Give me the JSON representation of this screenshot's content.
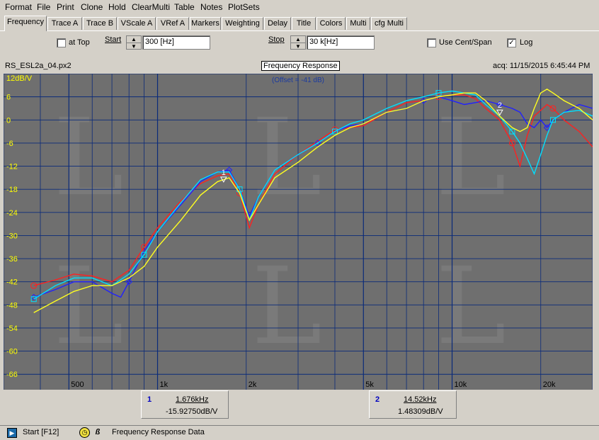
{
  "menu": [
    "Format",
    "File",
    "Print",
    "Clone",
    "Hold",
    "ClearMulti",
    "Table",
    "Notes",
    "PlotSets"
  ],
  "tabs": [
    "Frequency",
    "Trace A",
    "Trace B",
    "VScale A",
    "VRef A",
    "Markers",
    "Weighting",
    "Delay",
    "Title",
    "Colors",
    "Multi",
    "cfg Multi"
  ],
  "toolbar": {
    "at_top_label": "at Top",
    "start_label": "Start",
    "start_value": "300 [Hz]",
    "stop_label": "Stop",
    "stop_value": "30 k[Hz]",
    "use_cent_span_label": "Use Cent/Span",
    "log_label": "Log",
    "log_checked": "✓"
  },
  "header": {
    "file_name": "RS_ESL2a_04.px2",
    "plot_title": "Frequency Response",
    "acq": "acq: 11/15/2015 6:45:44 PM",
    "offset": "(Offset = -41 dB)"
  },
  "chart_data": {
    "type": "line",
    "xscale": "log",
    "xlim": [
      300,
      30000
    ],
    "ylim": [
      -70,
      12
    ],
    "ylabel": "12dB/V",
    "y_ticks": [
      6,
      0,
      -6,
      -12,
      -18,
      -24,
      -30,
      -36,
      -42,
      -48,
      -54,
      -60,
      -66
    ],
    "x_tick_labels": [
      {
        "f": 500,
        "label": "500"
      },
      {
        "f": 1000,
        "label": "1k"
      },
      {
        "f": 2000,
        "label": "2k"
      },
      {
        "f": 5000,
        "label": "5k"
      },
      {
        "f": 10000,
        "label": "10k"
      },
      {
        "f": 20000,
        "label": "20k"
      }
    ],
    "grid": true,
    "series": [
      {
        "color": "#ff2020",
        "points": [
          [
            380,
            -43
          ],
          [
            450,
            -41.5
          ],
          [
            520,
            -40
          ],
          [
            600,
            -40.5
          ],
          [
            700,
            -42
          ],
          [
            800,
            -39
          ],
          [
            900,
            -33
          ],
          [
            1000,
            -28
          ],
          [
            1200,
            -21
          ],
          [
            1400,
            -16.5
          ],
          [
            1600,
            -14.5
          ],
          [
            1750,
            -14
          ],
          [
            1900,
            -19
          ],
          [
            2050,
            -28
          ],
          [
            2200,
            -22
          ],
          [
            2500,
            -14
          ],
          [
            3000,
            -9
          ],
          [
            3500,
            -5.5
          ],
          [
            4000,
            -2.5
          ],
          [
            4500,
            -2
          ],
          [
            5000,
            -1.5
          ],
          [
            6000,
            2
          ],
          [
            7000,
            4.5
          ],
          [
            8000,
            5
          ],
          [
            9000,
            6
          ],
          [
            10000,
            6.5
          ],
          [
            11000,
            6.5
          ],
          [
            12000,
            5.5
          ],
          [
            13000,
            3
          ],
          [
            14500,
            0
          ],
          [
            16000,
            -6
          ],
          [
            17000,
            -12
          ],
          [
            18000,
            -4
          ],
          [
            19000,
            1
          ],
          [
            20000,
            2.5
          ],
          [
            21000,
            4
          ],
          [
            22000,
            3
          ],
          [
            24000,
            0
          ],
          [
            27000,
            -3
          ],
          [
            30000,
            -7
          ]
        ]
      },
      {
        "color": "#2020ff",
        "points": [
          [
            380,
            -46
          ],
          [
            450,
            -44
          ],
          [
            520,
            -42
          ],
          [
            600,
            -42
          ],
          [
            700,
            -45
          ],
          [
            750,
            -46
          ],
          [
            800,
            -42
          ],
          [
            900,
            -34
          ],
          [
            1000,
            -29
          ],
          [
            1200,
            -22
          ],
          [
            1400,
            -16
          ],
          [
            1600,
            -13.5
          ],
          [
            1750,
            -13
          ],
          [
            1900,
            -18
          ],
          [
            2050,
            -25
          ],
          [
            2200,
            -20
          ],
          [
            2500,
            -13
          ],
          [
            3000,
            -9
          ],
          [
            3500,
            -6
          ],
          [
            4000,
            -3
          ],
          [
            4500,
            -1.5
          ],
          [
            5000,
            -1
          ],
          [
            6000,
            2
          ],
          [
            7000,
            3
          ],
          [
            8000,
            5
          ],
          [
            9000,
            6
          ],
          [
            10000,
            5
          ],
          [
            11000,
            4
          ],
          [
            12000,
            4.5
          ],
          [
            13000,
            5
          ],
          [
            14500,
            4
          ],
          [
            16000,
            3
          ],
          [
            17000,
            2
          ],
          [
            18000,
            -1
          ],
          [
            19000,
            -2
          ],
          [
            20000,
            0
          ],
          [
            21000,
            -2
          ],
          [
            22000,
            0
          ],
          [
            24000,
            2
          ],
          [
            27000,
            4
          ],
          [
            30000,
            3
          ]
        ]
      },
      {
        "color": "#00e0ff",
        "points": [
          [
            380,
            -46.5
          ],
          [
            450,
            -43
          ],
          [
            520,
            -41
          ],
          [
            600,
            -41
          ],
          [
            700,
            -43
          ],
          [
            800,
            -40
          ],
          [
            900,
            -35
          ],
          [
            1000,
            -29
          ],
          [
            1200,
            -21.5
          ],
          [
            1400,
            -15.5
          ],
          [
            1600,
            -13.5
          ],
          [
            1750,
            -13.5
          ],
          [
            1900,
            -18
          ],
          [
            2050,
            -26
          ],
          [
            2200,
            -20
          ],
          [
            2500,
            -13
          ],
          [
            3000,
            -9
          ],
          [
            3500,
            -6
          ],
          [
            4000,
            -3
          ],
          [
            4500,
            -1
          ],
          [
            5000,
            0
          ],
          [
            6000,
            3
          ],
          [
            7000,
            5
          ],
          [
            8000,
            6
          ],
          [
            9000,
            7
          ],
          [
            10000,
            7.5
          ],
          [
            11000,
            7
          ],
          [
            12000,
            6.5
          ],
          [
            13000,
            4
          ],
          [
            14500,
            1
          ],
          [
            16000,
            -3
          ],
          [
            17000,
            -6
          ],
          [
            18000,
            -10
          ],
          [
            19000,
            -14
          ],
          [
            20000,
            -9
          ],
          [
            21000,
            -4
          ],
          [
            22000,
            0
          ],
          [
            24000,
            2
          ],
          [
            27000,
            2.5
          ],
          [
            30000,
            1
          ]
        ]
      },
      {
        "color": "#ffff20",
        "points": [
          [
            380,
            -50
          ],
          [
            450,
            -47
          ],
          [
            520,
            -44.5
          ],
          [
            600,
            -43
          ],
          [
            700,
            -43
          ],
          [
            800,
            -41
          ],
          [
            900,
            -38
          ],
          [
            1000,
            -33
          ],
          [
            1200,
            -26
          ],
          [
            1400,
            -19.5
          ],
          [
            1600,
            -16
          ],
          [
            1750,
            -15
          ],
          [
            1900,
            -19
          ],
          [
            2050,
            -26
          ],
          [
            2200,
            -22
          ],
          [
            2500,
            -15
          ],
          [
            3000,
            -11
          ],
          [
            3500,
            -7
          ],
          [
            4000,
            -4
          ],
          [
            4500,
            -2
          ],
          [
            5000,
            -1
          ],
          [
            6000,
            2
          ],
          [
            7000,
            3
          ],
          [
            8000,
            5
          ],
          [
            9000,
            6
          ],
          [
            10000,
            6.5
          ],
          [
            11000,
            7
          ],
          [
            12000,
            7
          ],
          [
            13000,
            5
          ],
          [
            14500,
            1
          ],
          [
            16000,
            -2
          ],
          [
            17000,
            -3
          ],
          [
            18000,
            -2
          ],
          [
            19000,
            3
          ],
          [
            20000,
            7
          ],
          [
            21000,
            8
          ],
          [
            22000,
            7
          ],
          [
            24000,
            5
          ],
          [
            27000,
            3
          ],
          [
            30000,
            0
          ]
        ]
      }
    ],
    "markers": [
      {
        "label": "1",
        "f": 1676,
        "value": -15.9275
      },
      {
        "label": "2",
        "f": 14520,
        "value": 1.48309
      }
    ]
  },
  "cursors": [
    {
      "num": "1",
      "freq": "1.676kHz",
      "value": "-15.92750dB/V"
    },
    {
      "num": "2",
      "freq": "14.52kHz",
      "value": "1.48309dB/V"
    }
  ],
  "status": {
    "start_button": "Start [F12]",
    "description": "Frequency Response Data"
  }
}
